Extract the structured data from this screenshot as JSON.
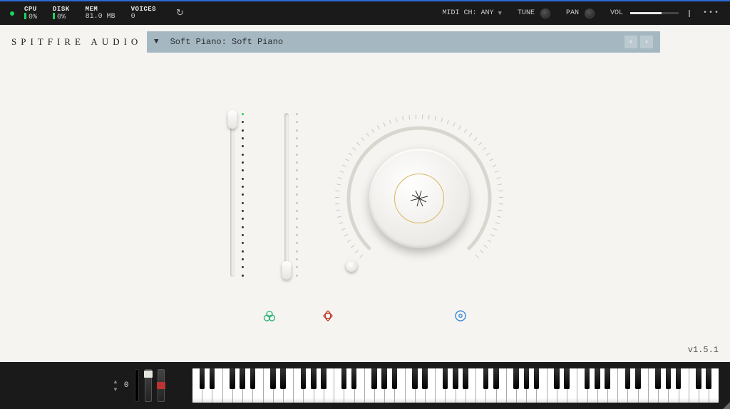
{
  "topbar": {
    "cpu_label": "CPU",
    "cpu_value": "0%",
    "disk_label": "DISK",
    "disk_value": "0%",
    "mem_label": "MEM",
    "mem_value": "81.0 MB",
    "voices_label": "VOICES",
    "voices_value": "0",
    "midi_label": "MIDI CH:",
    "midi_value": "ANY",
    "tune_label": "TUNE",
    "pan_label": "PAN",
    "vol_label": "VOL"
  },
  "brand": "SPITFIRE AUDIO",
  "preset": {
    "name": "Soft Piano: Soft Piano"
  },
  "velocity": {
    "value": "0"
  },
  "version": "v1.5.1",
  "colors": {
    "green": "#1bd65e",
    "preset_bg": "#a5b8c2",
    "icon_green": "#2bb573",
    "icon_red": "#c0392b",
    "icon_blue": "#2a7fd6"
  }
}
